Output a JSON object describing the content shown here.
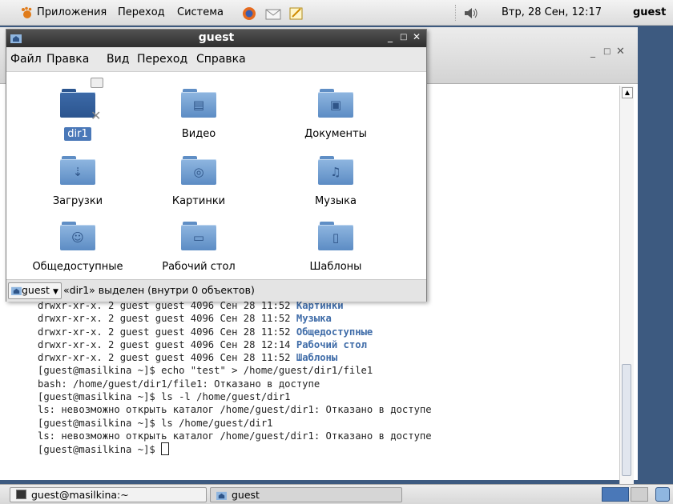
{
  "top_panel": {
    "apps_menu": "Приложения",
    "places_menu": "Переход",
    "system_menu": "Система",
    "datetime": "Втр, 28 Сен, 12:17",
    "username": "guest"
  },
  "terminal": {
    "lines": [
      {
        "prefix": "drwxr-xr-x. 2 guest guest 4096 Сен 28 11:52 ",
        "dir": "Картинки"
      },
      {
        "prefix": "drwxr-xr-x. 2 guest guest 4096 Сен 28 11:52 ",
        "dir": "Музыка"
      },
      {
        "prefix": "drwxr-xr-x. 2 guest guest 4096 Сен 28 11:52 ",
        "dir": "Общедоступные"
      },
      {
        "prefix": "drwxr-xr-x. 2 guest guest 4096 Сен 28 12:14 ",
        "dir": "Рабочий стол"
      },
      {
        "prefix": "drwxr-xr-x. 2 guest guest 4096 Сен 28 11:52 ",
        "dir": "Шаблоны"
      },
      {
        "prefix": "[guest@masilkina ~]$ echo \"test\" > /home/guest/dir1/file1",
        "dir": ""
      },
      {
        "prefix": "bash: /home/guest/dir1/file1: Отказано в доступе",
        "dir": ""
      },
      {
        "prefix": "[guest@masilkina ~]$ ls -l /home/guest/dir1",
        "dir": ""
      },
      {
        "prefix": "ls: невозможно открыть каталог /home/guest/dir1: Отказано в доступе",
        "dir": ""
      },
      {
        "prefix": "[guest@masilkina ~]$ ls /home/guest/dir1",
        "dir": ""
      },
      {
        "prefix": "ls: невозможно открыть каталог /home/guest/dir1: Отказано в доступе",
        "dir": ""
      },
      {
        "prefix": "[guest@masilkina ~]$ ",
        "dir": ""
      }
    ]
  },
  "file_manager": {
    "title": "guest",
    "menu": [
      "Файл",
      "Правка",
      "Вид",
      "Переход",
      "Справка"
    ],
    "items": [
      {
        "label": "dir1",
        "icon": "locked-folder-icon",
        "selected": true
      },
      {
        "label": "Видео",
        "icon": "video-folder-icon"
      },
      {
        "label": "Документы",
        "icon": "documents-folder-icon"
      },
      {
        "label": "Загрузки",
        "icon": "downloads-folder-icon"
      },
      {
        "label": "Картинки",
        "icon": "pictures-folder-icon"
      },
      {
        "label": "Музыка",
        "icon": "music-folder-icon"
      },
      {
        "label": "Общедоступные",
        "icon": "public-folder-icon"
      },
      {
        "label": "Рабочий стол",
        "icon": "desktop-folder-icon"
      },
      {
        "label": "Шаблоны",
        "icon": "templates-folder-icon"
      }
    ],
    "status_location": "guest",
    "status_text": "«dir1» выделен (внутри 0 объектов)"
  },
  "bottom_panel": {
    "tasks": [
      "guest@masilkina:~",
      "guest"
    ]
  },
  "colors": {
    "selection": "#4a78b8",
    "terminal_dir": "#3f6ca8",
    "titlebar_dark": "#3a3a3a"
  }
}
